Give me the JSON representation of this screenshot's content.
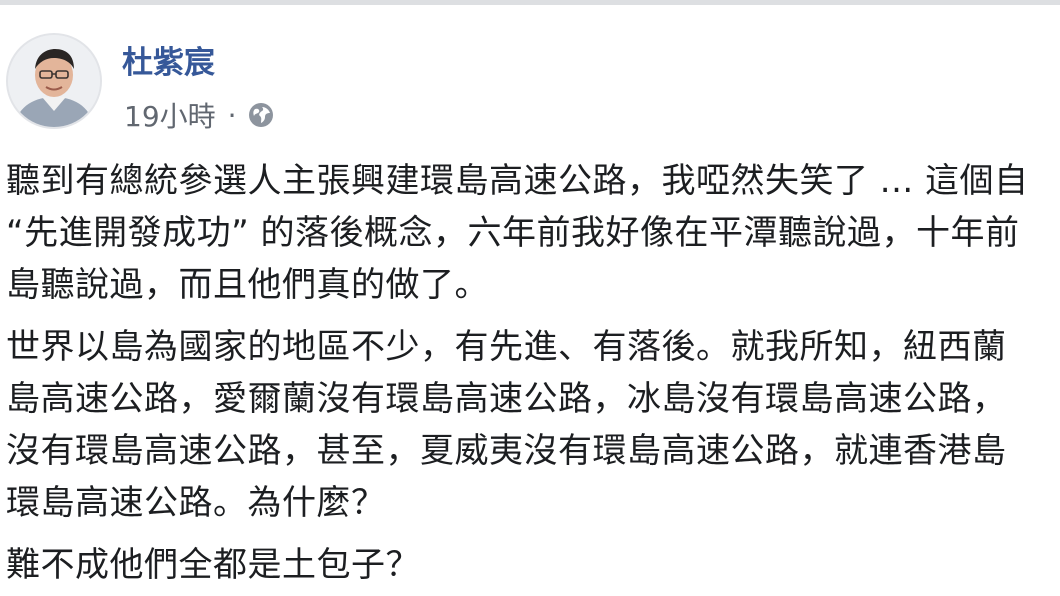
{
  "post": {
    "author": "杜紫宸",
    "timestamp": "19小時",
    "separator": "·",
    "privacy_icon": "globe-icon",
    "paragraphs": [
      {
        "lines": [
          "聽到有總統參選人主張興建環島高速公路，我啞然失笑了 ... 這個自",
          "“先進開發成功” 的落後概念，六年前我好像在平潭聽說過，十年前",
          "島聽說過，而且他們真的做了。"
        ]
      },
      {
        "lines": [
          "世界以島為國家的地區不少，有先進、有落後。就我所知，紐西蘭",
          "島高速公路，愛爾蘭沒有環島高速公路，冰島沒有環島高速公路，",
          "沒有環島高速公路，甚至，夏威夷沒有環島高速公路，就連香港島",
          "環島高速公路。為什麼？"
        ]
      },
      {
        "lines": [
          "難不成他們全都是土包子？"
        ]
      }
    ]
  }
}
